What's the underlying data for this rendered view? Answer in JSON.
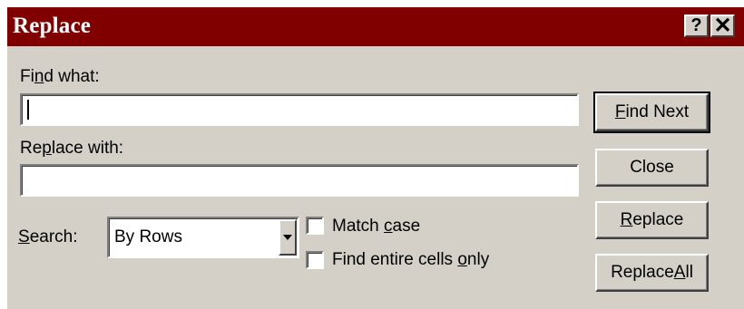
{
  "window": {
    "title": "Replace",
    "help_glyph": "?",
    "close_glyph": "✕",
    "titlebar_color": "#800000",
    "face_color": "#d4d0c8"
  },
  "find": {
    "label_pre": "Fi",
    "label_key": "n",
    "label_post": "d what:",
    "value": ""
  },
  "replace": {
    "label_pre": "Re",
    "label_key": "p",
    "label_post": "lace with:",
    "value": ""
  },
  "search": {
    "label_pre": "",
    "label_key": "S",
    "label_post": "earch:",
    "selected": "By Rows",
    "icon": "dropdown-arrow-icon"
  },
  "options": {
    "match_case": {
      "pre": "Match ",
      "key": "c",
      "post": "ase",
      "checked": false
    },
    "entire_cells": {
      "pre": "Find entire cells ",
      "key": "o",
      "post": "nly",
      "checked": false
    }
  },
  "buttons": {
    "find_next": {
      "pre": "",
      "key": "F",
      "post": "ind Next"
    },
    "close": {
      "pre": "Close",
      "key": "",
      "post": ""
    },
    "replace": {
      "pre": "",
      "key": "R",
      "post": "eplace"
    },
    "replace_all": {
      "pre": "Replace ",
      "key": "A",
      "post": "ll"
    }
  }
}
